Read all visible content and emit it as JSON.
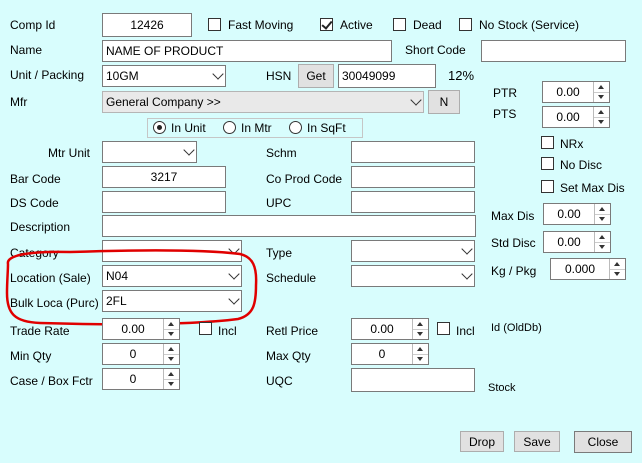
{
  "comp": {
    "label": "Comp Id",
    "value": "12426"
  },
  "flags": {
    "fast_moving": {
      "label": "Fast Moving",
      "checked": false
    },
    "active": {
      "label": "Active",
      "checked": true
    },
    "dead": {
      "label": "Dead",
      "checked": false
    },
    "no_stock": {
      "label": "No Stock (Service)",
      "checked": false
    }
  },
  "name": {
    "label": "Name",
    "value": "NAME OF PRODUCT"
  },
  "short_code": {
    "label": "Short Code",
    "value": ""
  },
  "unit_packing": {
    "label": "Unit / Packing",
    "value": "10GM"
  },
  "hsn": {
    "label": "HSN",
    "get_button": "Get",
    "value": "30049099",
    "gst": "12%"
  },
  "mfr": {
    "label": "Mfr",
    "value": "General Company  >>",
    "n_button": "N"
  },
  "unit_mode": {
    "options": [
      "In Unit",
      "In Mtr",
      "In SqFt"
    ],
    "selected": "In Unit"
  },
  "mtr_unit": {
    "label": "Mtr Unit",
    "value": ""
  },
  "schm": {
    "label": "Schm",
    "value": ""
  },
  "bar_code": {
    "label": "Bar Code",
    "value": "3217"
  },
  "co_prod_code": {
    "label": "Co Prod Code",
    "value": ""
  },
  "ds_code": {
    "label": "DS Code",
    "value": ""
  },
  "upc": {
    "label": "UPC",
    "value": ""
  },
  "description": {
    "label": "Description",
    "value": ""
  },
  "category": {
    "label": "Category",
    "value": ""
  },
  "type": {
    "label": "Type",
    "value": ""
  },
  "location_sale": {
    "label": "Location (Sale)",
    "value": "N04"
  },
  "schedule": {
    "label": "Schedule",
    "value": ""
  },
  "bulk_loca": {
    "label": "Bulk Loca (Purc)",
    "value": "2FL"
  },
  "trade_rate": {
    "label": "Trade Rate",
    "value": "0.00",
    "incl_label": "Incl"
  },
  "retl_price": {
    "label": "Retl Price",
    "value": "0.00",
    "incl_label": "Incl"
  },
  "min_qty": {
    "label": "Min Qty",
    "value": "0"
  },
  "max_qty": {
    "label": "Max Qty",
    "value": "0"
  },
  "case_box": {
    "label": "Case / Box Fctr",
    "value": "0"
  },
  "uqc": {
    "label": "UQC",
    "value": ""
  },
  "right_panel": {
    "ptr": {
      "label": "PTR",
      "value": "0.00"
    },
    "pts": {
      "label": "PTS",
      "value": "0.00"
    },
    "nrx": {
      "label": "NRx",
      "checked": false
    },
    "no_disc": {
      "label": "No Disc",
      "checked": false
    },
    "set_max_dis": {
      "label": "Set Max Dis",
      "checked": false
    },
    "max_dis": {
      "label": "Max Dis",
      "value": "0.00"
    },
    "std_disc": {
      "label": "Std Disc",
      "value": "0.00"
    },
    "kg_pkg": {
      "label": "Kg / Pkg",
      "value": "0.000"
    },
    "id_old": "Id (OldDb)",
    "stock": "Stock"
  },
  "buttons": {
    "drop": "Drop",
    "save": "Save",
    "close": "Close"
  },
  "colors": {
    "background": "#d8fdfd",
    "highlight": "#e00000"
  }
}
